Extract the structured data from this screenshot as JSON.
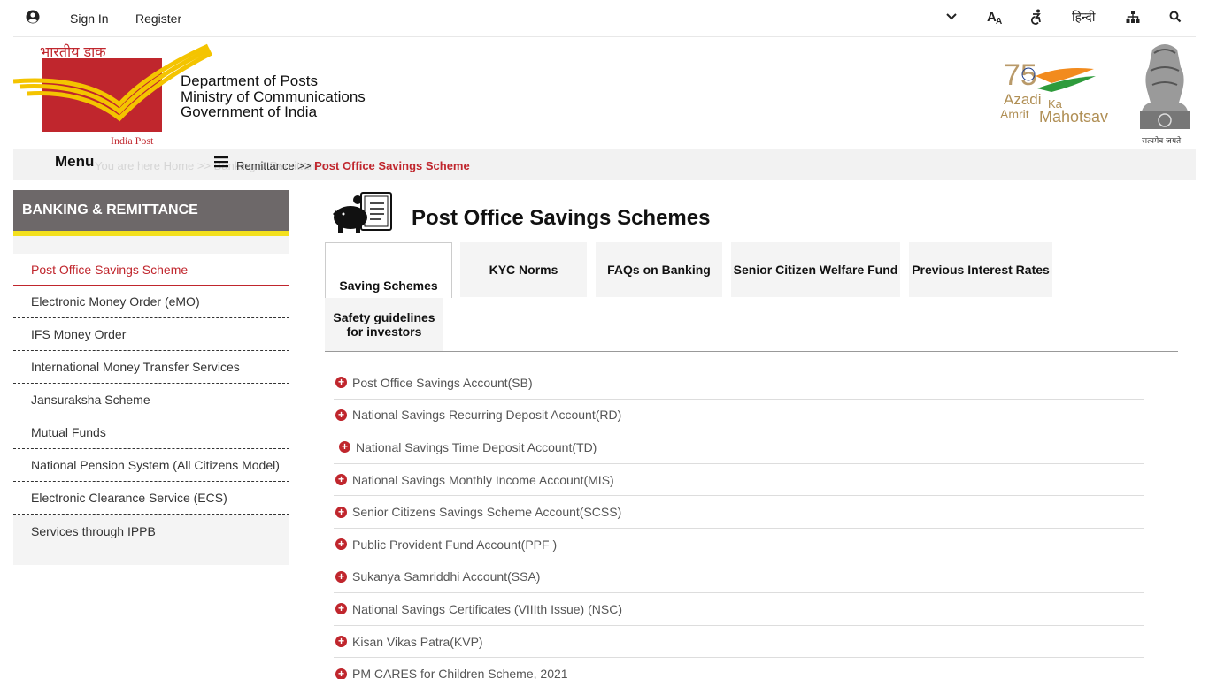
{
  "topbar": {
    "sign_in": "Sign In",
    "register": "Register",
    "language": "हिन्दी",
    "icons": [
      "user-circle-icon",
      "chevron-down-icon",
      "font-size-icon",
      "accessibility-icon",
      "sitemap-icon",
      "search-icon"
    ]
  },
  "header": {
    "logo_hindi": "भारतीय डाक",
    "logo_english": "India Post",
    "dept_lines": [
      "Department of Posts",
      "Ministry of Communications",
      "Government of India"
    ],
    "azadi": {
      "number": "75",
      "line1": "Azadi",
      "line1b": "Ka",
      "line2": "Amrit",
      "line2b": "Mahotsav"
    },
    "emblem_motto": "सत्यमेव जयते"
  },
  "breadcrumb": {
    "menu_label": "Menu",
    "ghost_text": "You are here  Home >> Banking & Remittance",
    "path_text": "Remittance >> ",
    "current": "Post Office Savings Scheme"
  },
  "sidebar": {
    "heading": "BANKING & REMITTANCE",
    "items": [
      "Post Office Savings Scheme",
      "Electronic Money Order (eMO)",
      "IFS Money Order",
      "International Money Transfer Services",
      "Jansuraksha Scheme",
      "Mutual Funds",
      "National Pension System (All Citizens Model)",
      "Electronic Clearance Service (ECS)",
      "Services through IPPB"
    ],
    "active_index": 0
  },
  "main": {
    "title": "Post Office Savings Schemes",
    "tabs": [
      "Saving Schemes",
      "KYC Norms",
      "FAQs on Banking",
      "Senior Citizen Welfare Fund",
      "Previous Interest Rates",
      "Safety guidelines for investors"
    ],
    "active_tab": 0,
    "schemes": [
      "Post Office Savings Account(SB)",
      "National Savings Recurring Deposit Account(RD)",
      "National Savings Time Deposit Account(TD)",
      "National Savings Monthly Income Account(MIS)",
      "Senior Citizens Savings Scheme Account(SCSS)",
      "Public Provident Fund Account(PPF )",
      "Sukanya Samriddhi Account(SSA)",
      "National Savings Certificates (VIIIth Issue) (NSC)",
      "Kisan Vikas Patra(KVP)",
      "PM CARES for Children Scheme, 2021"
    ],
    "expand_symbol": "+"
  },
  "colors": {
    "brand_red": "#c0262d",
    "sidebar_header": "#6d6869",
    "yellow_stripe": "#f3e01d"
  }
}
